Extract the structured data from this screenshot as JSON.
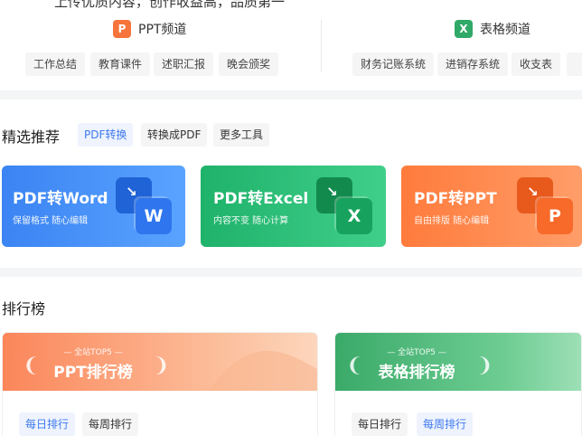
{
  "top_cut_text": "上传优质内容，创作收益高，品质第一",
  "channels": {
    "ppt": {
      "icon": "ppt-icon",
      "icon_glyph": "P",
      "title": "PPT频道",
      "tags": [
        "工作总结",
        "教育课件",
        "述职汇报",
        "晚会颁奖"
      ]
    },
    "excel": {
      "icon": "excel-icon",
      "icon_glyph": "X",
      "title": "表格频道",
      "tags": [
        "财务记账系统",
        "进销存系统",
        "收支表"
      ]
    }
  },
  "featured": {
    "title": "精选推荐",
    "tabs": [
      "PDF转换",
      "转换成PDF",
      "更多工具"
    ],
    "active_tab": 0,
    "cards": [
      {
        "title": "PDF转Word",
        "subtitle": "保留格式 随心编辑",
        "letter": "W",
        "icon": "pdf-to-word-icon",
        "colors": [
          "#3d88f4",
          "#5ea6ff"
        ]
      },
      {
        "title": "PDF转Excel",
        "subtitle": "内容不变 随心计算",
        "letter": "X",
        "icon": "pdf-to-excel-icon",
        "colors": [
          "#22b36c",
          "#3ed08a"
        ]
      },
      {
        "title": "PDF转PPT",
        "subtitle": "自由排版 随心编辑",
        "letter": "P",
        "icon": "pdf-to-ppt-icon",
        "colors": [
          "#ff7d3f",
          "#ff9e6a"
        ]
      }
    ]
  },
  "ranking": {
    "title": "排行榜",
    "boards": [
      {
        "small": "全站TOP5",
        "title": "PPT排行榜",
        "tabs": [
          "每日排行",
          "每周排行"
        ],
        "active_tab": 0,
        "colors": [
          "#fb8a5f",
          "#fcc7a8"
        ]
      },
      {
        "small": "全站TOP5",
        "title": "表格排行榜",
        "tabs": [
          "每日排行",
          "每周排行"
        ],
        "active_tab": 1,
        "colors": [
          "#3fb06f",
          "#7fd49f"
        ]
      }
    ]
  },
  "colors": {
    "accent_blue": "#3f7af0",
    "band_gray": "#f4f5f6"
  }
}
